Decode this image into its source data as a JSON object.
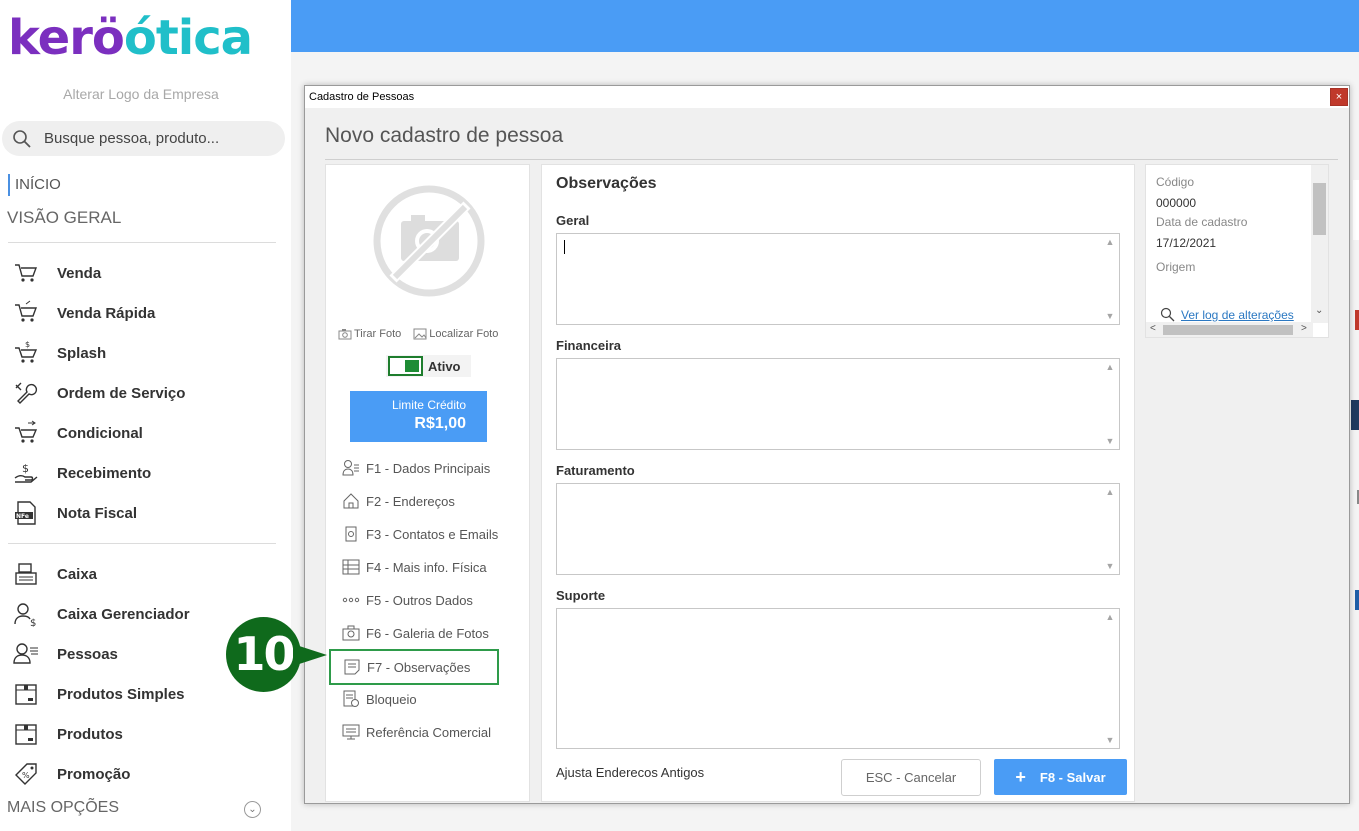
{
  "sidebar": {
    "logo": {
      "part1": "kerö",
      "part2": "ótica",
      "accent_purple": "#7b2fbf",
      "accent_teal": "#20bfc9"
    },
    "alter_logo": "Alterar Logo da Empresa",
    "search_placeholder": "Busque pessoa, produto...",
    "inicio": "INÍCIO",
    "visao_geral": "VISÃO GERAL",
    "menu": [
      {
        "label": "Venda",
        "icon": "cart-icon"
      },
      {
        "label": "Venda Rápida",
        "icon": "cart-fast-icon"
      },
      {
        "label": "Splash",
        "icon": "cart-dollar-icon"
      },
      {
        "label": "Ordem de Serviço",
        "icon": "wrench-icon"
      },
      {
        "label": "Condicional",
        "icon": "cart-arrows-icon"
      },
      {
        "label": "Recebimento",
        "icon": "hand-money-icon"
      },
      {
        "label": "Nota Fiscal",
        "icon": "nfe-document-icon"
      },
      {
        "label": "Caixa",
        "icon": "cash-register-icon"
      },
      {
        "label": "Caixa Gerenciador",
        "icon": "user-dollar-icon"
      },
      {
        "label": "Pessoas",
        "icon": "user-list-icon"
      },
      {
        "label": "Produtos Simples",
        "icon": "box-icon"
      },
      {
        "label": "Produtos",
        "icon": "box-icon"
      },
      {
        "label": "Promoção",
        "icon": "tag-percent-icon"
      }
    ],
    "mais_opcoes": "MAIS OPÇÕES"
  },
  "dialog": {
    "window_title": "Cadastro de Pessoas",
    "close_label": "×",
    "heading": "Novo cadastro de pessoa",
    "left": {
      "tirar_foto": "Tirar Foto",
      "localizar_foto": "Localizar Foto",
      "ativo_label": "Ativo",
      "ativo_on": true,
      "limite_label": "Limite Crédito",
      "limite_value": "R$1,00",
      "nav": [
        {
          "label": "F1 - Dados Principais",
          "icon": "user-card-icon"
        },
        {
          "label": "F2 - Endereços",
          "icon": "house-icon"
        },
        {
          "label": "F3 - Contatos e Emails",
          "icon": "at-sign-icon"
        },
        {
          "label": "F4 - Mais info. Física",
          "icon": "grid-icon"
        },
        {
          "label": "F5 - Outros Dados",
          "icon": "dots-icon"
        },
        {
          "label": "F6 - Galeria de Fotos",
          "icon": "camera-icon"
        },
        {
          "label": "F7 - Observações",
          "icon": "note-icon",
          "selected": true
        },
        {
          "label": "Bloqueio",
          "icon": "lock-list-icon"
        },
        {
          "label": "Referência Comercial",
          "icon": "monitor-icon"
        }
      ]
    },
    "center": {
      "title": "Observações",
      "fields": [
        {
          "label": "Geral",
          "value": ""
        },
        {
          "label": "Financeira",
          "value": ""
        },
        {
          "label": "Faturamento",
          "value": ""
        },
        {
          "label": "Suporte",
          "value": ""
        }
      ],
      "ajusta": "Ajusta Enderecos Antigos",
      "cancel_label": "ESC - Cancelar",
      "save_label": "F8 - Salvar",
      "save_icon": "plus-icon"
    },
    "right": {
      "codigo_label": "Código",
      "codigo_value": "000000",
      "data_label": "Data de cadastro",
      "data_value": "17/12/2021",
      "origem_label": "Origem",
      "log_link": "Ver log de alterações"
    }
  },
  "annotation": {
    "badge_number": "10",
    "badge_color": "#0f6a1c"
  },
  "colors": {
    "topbar": "#4a9cf5",
    "primary_button": "#4a9cf5",
    "selection_border": "#2e9b4a"
  }
}
